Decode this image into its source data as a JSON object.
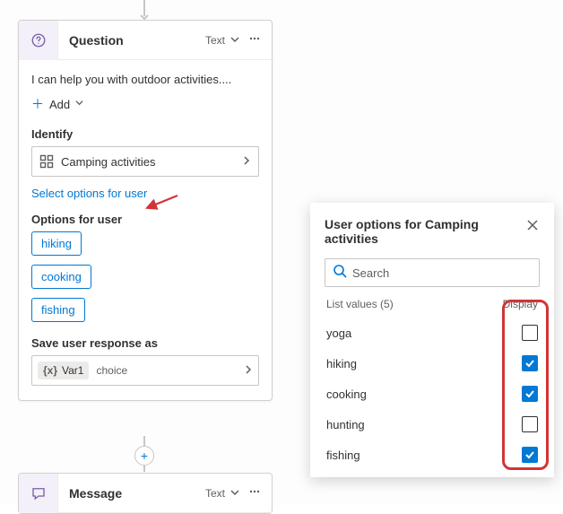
{
  "question_card": {
    "title": "Question",
    "type_label": "Text",
    "message_text": "I can help you with outdoor activities....",
    "add_label": "Add",
    "identify_label": "Identify",
    "identify_value": "Camping activities",
    "select_options_link": "Select options for user",
    "options_label": "Options for user",
    "options": [
      "hiking",
      "cooking",
      "fishing"
    ],
    "save_as_label": "Save user response as",
    "variable_name": "Var1",
    "variable_type": "choice",
    "variable_fx": "{x}"
  },
  "message_card": {
    "title": "Message",
    "type_label": "Text"
  },
  "panel": {
    "title": "User options for Camping activities",
    "search_placeholder": "Search",
    "list_values_label": "List values (5)",
    "display_label": "Display",
    "items": [
      {
        "label": "yoga",
        "checked": false
      },
      {
        "label": "hiking",
        "checked": true
      },
      {
        "label": "cooking",
        "checked": true
      },
      {
        "label": "hunting",
        "checked": false
      },
      {
        "label": "fishing",
        "checked": true
      }
    ]
  }
}
